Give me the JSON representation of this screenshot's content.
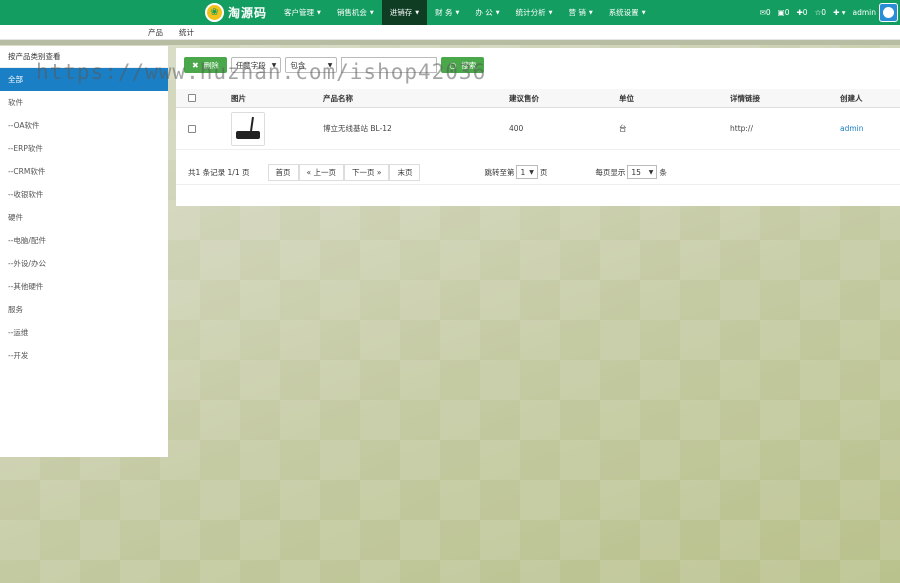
{
  "brand": {
    "name": "淘源码"
  },
  "nav": {
    "items": [
      {
        "label": "客户管理",
        "active": false
      },
      {
        "label": "销售机会",
        "active": false
      },
      {
        "label": "进销存",
        "active": true
      },
      {
        "label": "财 务",
        "active": false
      },
      {
        "label": "办 公",
        "active": false
      },
      {
        "label": "统计分析",
        "active": false
      },
      {
        "label": "营 销",
        "active": false
      },
      {
        "label": "系统设置",
        "active": false
      }
    ],
    "right": {
      "mail": "✉0",
      "tasks": "▣0",
      "alerts": "✚0",
      "stars": "☆0",
      "plus": "✚ ▾",
      "user": "admin"
    }
  },
  "subnav": {
    "items": [
      "产品",
      "统计"
    ]
  },
  "sidebar": {
    "title": "按产品类别查看",
    "items": [
      {
        "label": "全部",
        "active": true
      },
      {
        "label": "软件"
      },
      {
        "label": "--OA软件"
      },
      {
        "label": "--ERP软件"
      },
      {
        "label": "--CRM软件"
      },
      {
        "label": "--收银软件"
      },
      {
        "label": "硬件"
      },
      {
        "label": "--电脑/配件"
      },
      {
        "label": "--外设/办公"
      },
      {
        "label": "--其他硬件"
      },
      {
        "label": "服务"
      },
      {
        "label": "--运维"
      },
      {
        "label": "--开发"
      }
    ]
  },
  "toolbar": {
    "delete_label": "删除",
    "field_select": "任意字段",
    "op_select": "包含",
    "search_value": "",
    "search_label": "搜索"
  },
  "table": {
    "headers": [
      "图片",
      "产品名称",
      "建议售价",
      "单位",
      "详情链接",
      "创建人"
    ],
    "rows": [
      {
        "name": "博立无线基站 BL-12",
        "price": "400",
        "unit": "台",
        "link": "http://",
        "creator": "admin"
      }
    ]
  },
  "pager": {
    "summary": "共1 条记录 1/1 页",
    "first": "首页",
    "prev": "« 上一页",
    "next": "下一页 »",
    "last": "末页",
    "jump_prefix": "跳转至第",
    "jump_value": "1",
    "jump_suffix": "页",
    "size_prefix": "每页显示",
    "size_value": "15",
    "size_suffix": "条"
  },
  "watermark": "https://www.huzhan.com/ishop42036"
}
